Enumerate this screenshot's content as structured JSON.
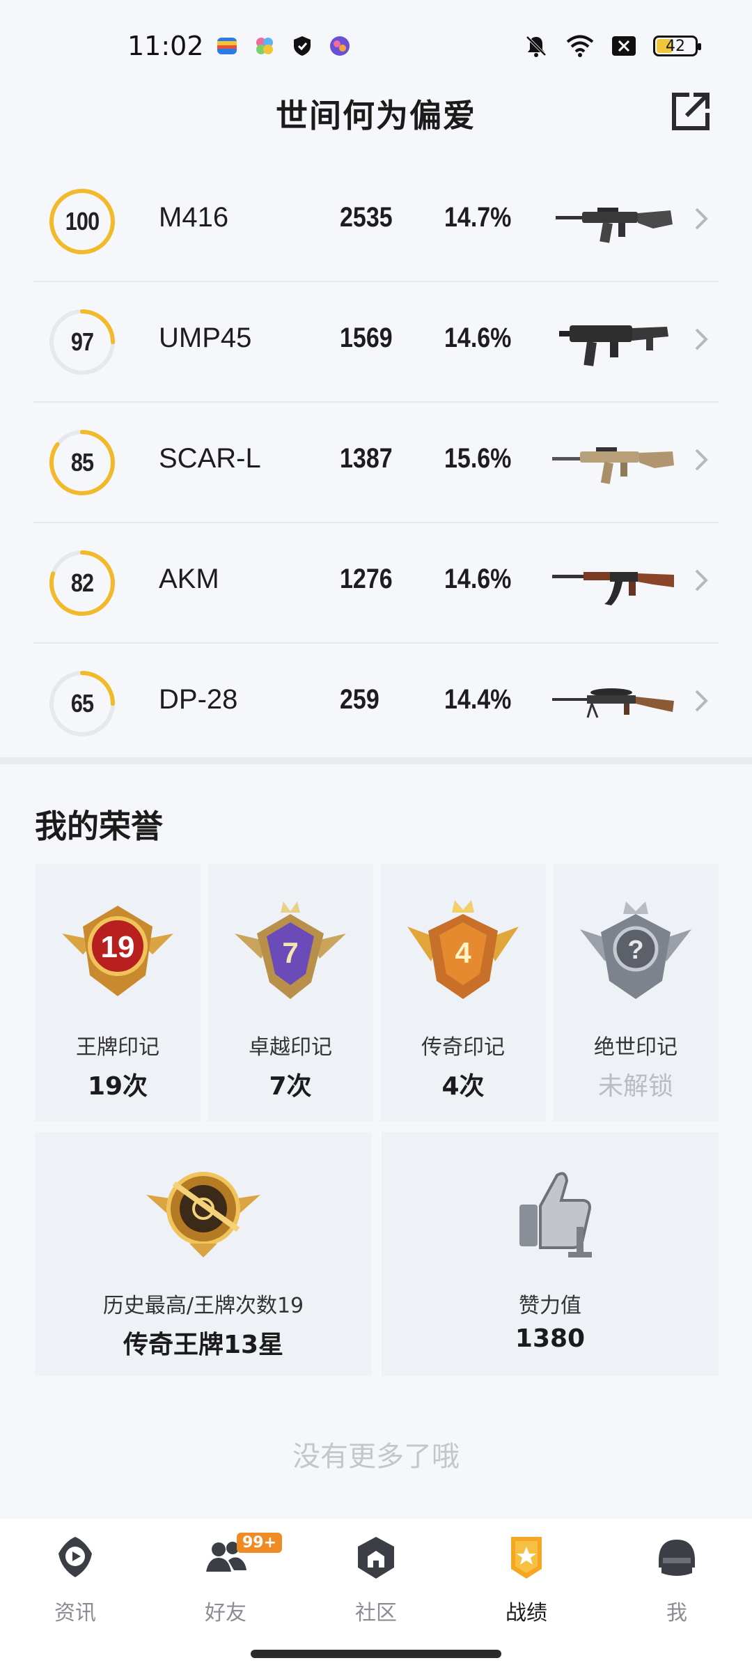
{
  "status_bar": {
    "time": "11:02",
    "battery_level": "42",
    "battery_fraction": 0.42
  },
  "header": {
    "title": "世间何为偏爱"
  },
  "weapons": [
    {
      "score": "100",
      "score_fraction": 1.0,
      "name": "M416",
      "kills": "2535",
      "percent": "14.7%",
      "image": "rifle-m416"
    },
    {
      "score": "97",
      "score_fraction": 0.25,
      "name": "UMP45",
      "kills": "1569",
      "percent": "14.6%",
      "image": "smg-ump45"
    },
    {
      "score": "85",
      "score_fraction": 0.85,
      "name": "SCAR-L",
      "kills": "1387",
      "percent": "15.6%",
      "image": "rifle-scarl"
    },
    {
      "score": "82",
      "score_fraction": 0.8,
      "name": "AKM",
      "kills": "1276",
      "percent": "14.6%",
      "image": "rifle-akm"
    },
    {
      "score": "65",
      "score_fraction": 0.25,
      "name": "DP-28",
      "kills": "259",
      "percent": "14.4%",
      "image": "lmg-dp28"
    }
  ],
  "honors": {
    "title": "我的荣誉",
    "badges": [
      {
        "label": "王牌印记",
        "count": "19次",
        "badge_text": "19",
        "icon": "ace-badge-icon"
      },
      {
        "label": "卓越印记",
        "count": "7次",
        "badge_text": "7",
        "icon": "excellence-badge-icon"
      },
      {
        "label": "传奇印记",
        "count": "4次",
        "badge_text": "4",
        "icon": "legend-badge-icon"
      },
      {
        "label": "绝世印记",
        "count": "未解锁",
        "badge_text": "?",
        "icon": "peerless-badge-icon"
      }
    ],
    "stats": [
      {
        "label": "历史最高/王牌次数19",
        "value": "传奇王牌13星",
        "icon": "legend-ace-emblem-icon"
      },
      {
        "label": "赞力值",
        "value": "1380",
        "icon": "thumbs-up-icon"
      }
    ]
  },
  "footer_text": "没有更多了哦",
  "nav": {
    "items": [
      {
        "label": "资讯",
        "icon": "news-icon"
      },
      {
        "label": "好友",
        "icon": "friends-icon",
        "badge": "99+"
      },
      {
        "label": "社区",
        "icon": "community-icon"
      },
      {
        "label": "战绩",
        "icon": "record-icon",
        "active": true
      },
      {
        "label": "我",
        "icon": "profile-icon"
      }
    ]
  },
  "colors": {
    "accent": "#f2b92a",
    "ring_track": "#e6e8ec",
    "badge_orange": "#f08a24",
    "locked_text": "#b9bcc2"
  }
}
